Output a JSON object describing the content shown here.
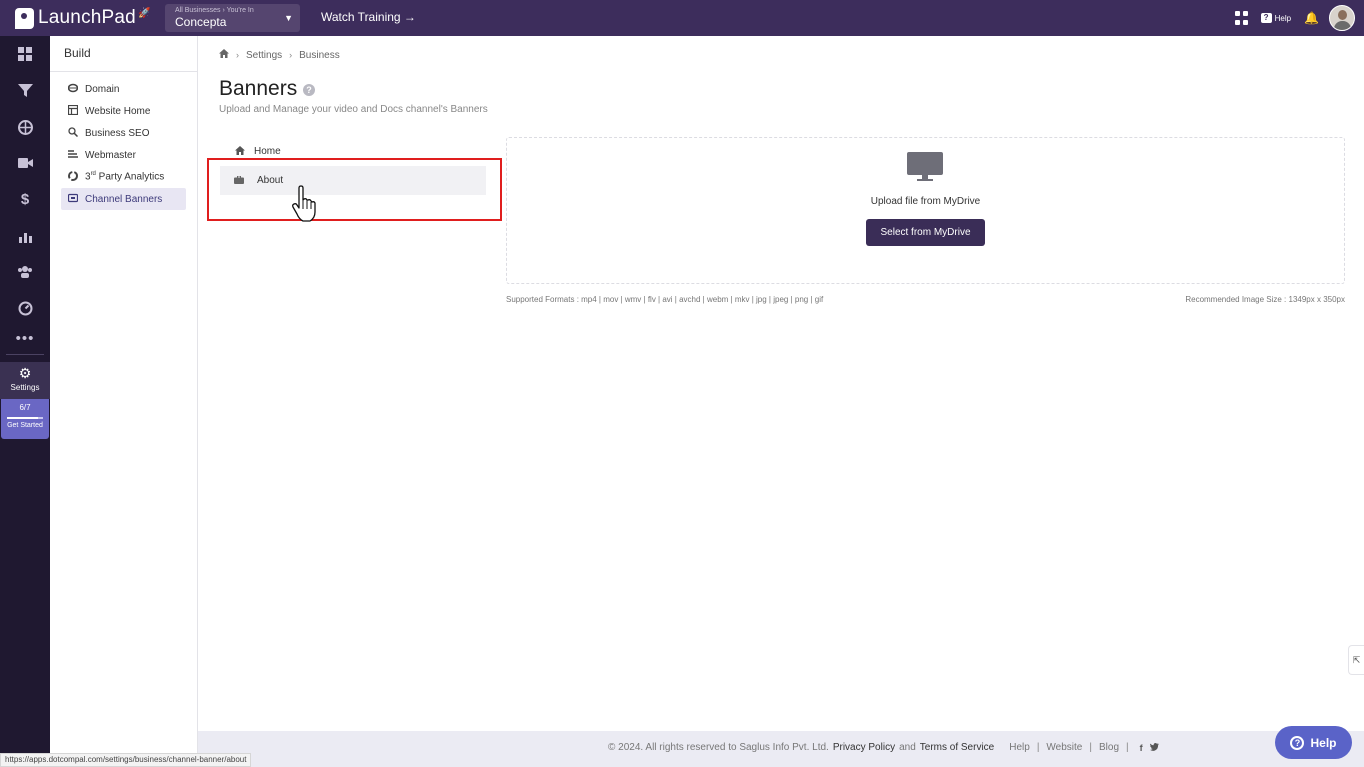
{
  "topbar": {
    "app_name": "LaunchPad",
    "business_select": {
      "small_label": "All Businesses  ›  You're In",
      "value": "Concepta"
    },
    "watch_training": "Watch Training →",
    "help_label": "Help"
  },
  "rail": {
    "items": [
      "dashboard-icon",
      "funnel-icon",
      "globe-icon",
      "video-icon",
      "dollar-icon",
      "analytics-icon",
      "users-icon",
      "gauge-icon",
      "more-icon"
    ],
    "settings_label": "Settings",
    "progress_fraction": "6/7",
    "progress_value": 0.857,
    "get_started_label": "Get Started"
  },
  "sidebar": {
    "title": "Build",
    "items": [
      {
        "label": "Domain",
        "icon": "globe-icon"
      },
      {
        "label": "Website Home",
        "icon": "layout-icon"
      },
      {
        "label": "Business SEO",
        "icon": "search-icon"
      },
      {
        "label": "Webmaster",
        "icon": "webmaster-icon"
      },
      {
        "label_prefix": "3",
        "label_sup": "rd",
        "label_suffix": " Party Analytics",
        "icon": "pie-icon"
      },
      {
        "label": "Channel Banners",
        "icon": "banner-icon",
        "active": true
      }
    ]
  },
  "breadcrumb": {
    "home_icon": "home-icon",
    "items": [
      "Settings",
      "Business"
    ]
  },
  "page": {
    "title": "Banners",
    "subtitle": "Upload and Manage your video and Docs channel's Banners"
  },
  "channels": [
    {
      "label": "Home",
      "icon": "home-icon"
    },
    {
      "label": "About",
      "icon": "briefcase-icon",
      "active": true
    }
  ],
  "upload": {
    "text": "Upload file from MyDrive",
    "button": "Select from MyDrive",
    "formats": "Supported Formats : mp4 | mov | wmv | flv | avi | avchd | webm | mkv | jpg | jpeg | png | gif",
    "recommended": "Recommended Image Size : 1349px x 350px"
  },
  "footer": {
    "copyright": "©  2024. All rights reserved to Saglus Info Pvt. Ltd.",
    "privacy": "Privacy Policy",
    "and": "and",
    "terms": "Terms of Service",
    "links": [
      "Help",
      "Website",
      "Blog"
    ]
  },
  "help_fab": "Help",
  "status_url": "https://apps.dotcompal.com/settings/business/channel-banner/about",
  "colors": {
    "topbar": "#3d2d5c",
    "rail": "#1f1830",
    "accent": "#3a2d57",
    "highlight": "#e01e1e",
    "fab": "#5a63c8"
  }
}
